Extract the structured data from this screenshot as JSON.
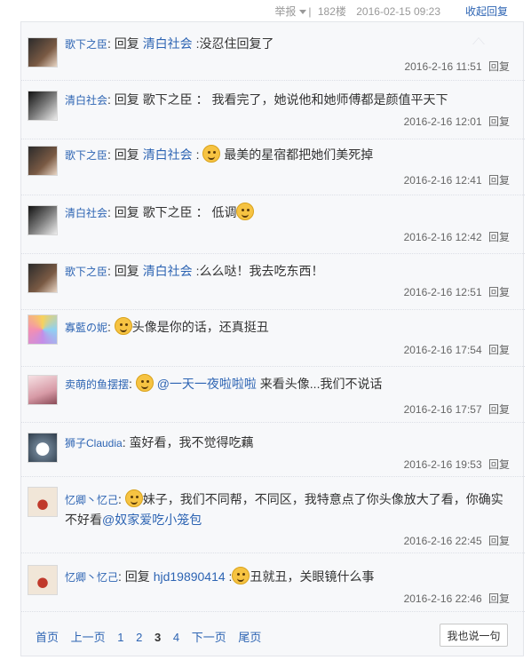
{
  "topbar": {
    "report": "举报",
    "floor": "182楼",
    "datetime": "2016-02-15 09:23",
    "collapse": "收起回复"
  },
  "reply_label": "回复",
  "replies": [
    {
      "user": "歌下之臣",
      "reply_word": "回复",
      "target": "清白社会",
      "text": "没忍住回复了",
      "time": "2016-2-16 11:51",
      "reply": "回复",
      "emoji": false
    },
    {
      "user": "清白社会",
      "reply_word": "回复",
      "target": "歌下之臣",
      "text": "我看完了，她说他和她师傅都是颜值平天下",
      "time": "2016-2-16 12:01",
      "reply": "回复",
      "emoji": false
    },
    {
      "user": "歌下之臣",
      "reply_word": "回复",
      "target": "清白社会",
      "text": "最美的星宿都把她们美死掉",
      "time": "2016-2-16 12:41",
      "reply": "回复",
      "emoji": true
    },
    {
      "user": "清白社会",
      "reply_word": "回复",
      "target": "歌下之臣",
      "text": "低调",
      "time": "2016-2-16 12:42",
      "reply": "回复",
      "emoji": true
    },
    {
      "user": "歌下之臣",
      "reply_word": "回复",
      "target": "清白社会",
      "text": "么么哒！我去吃东西！",
      "time": "2016-2-16 12:51",
      "reply": "回复",
      "emoji": false
    },
    {
      "user": "寡藍の妮",
      "text": "头像是你的话，还真挺丑",
      "time": "2016-2-16 17:54",
      "reply": "回复",
      "emoji": true
    },
    {
      "user": "卖萌的鱼摆摆",
      "mention": "@一天一夜啦啦啦",
      "text": "来看头像...我们不说话",
      "time": "2016-2-16 17:57",
      "reply": "回复",
      "emoji": true
    },
    {
      "user": "狮子Claudia",
      "text": "蛮好看，我不觉得吃藕",
      "time": "2016-2-16 19:53",
      "reply": "回复",
      "emoji": false
    },
    {
      "user": "忆卿丶忆己",
      "text": "妹子，我们不同帮，不同区，我特意点了你头像放大了看，你确实不好看",
      "mention": "@奴家爱吃小笼包",
      "time": "2016-2-16 22:45",
      "reply": "回复",
      "emoji": true
    },
    {
      "user": "忆卿丶忆己",
      "reply_word": "回复",
      "target": "hjd19890414",
      "text": "丑就丑，关眼镜什么事",
      "time": "2016-2-16 22:46",
      "reply": "回复",
      "emoji": true
    }
  ],
  "pager": {
    "first": "首页",
    "prev": "上一页",
    "pages": [
      "1",
      "2",
      "3",
      "4"
    ],
    "current": "3",
    "next": "下一页",
    "last": "尾页"
  },
  "say_button": "我也说一句",
  "colors": {
    "link": "#2d64b3",
    "panel_bg": "#f7f8fa",
    "emoji": "#f6c342"
  }
}
